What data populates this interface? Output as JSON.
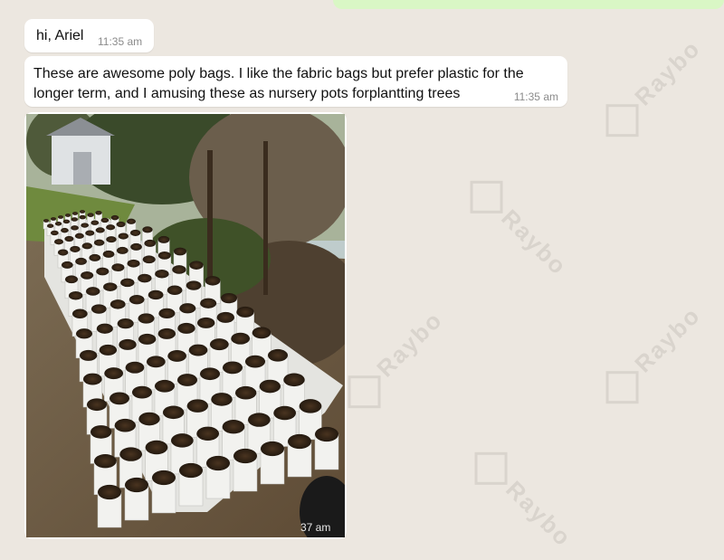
{
  "watermark": "Raybo",
  "messages": [
    {
      "text": "hi, Ariel",
      "time": "11:35 am"
    },
    {
      "text": "These are awesome poly bags. I like the fabric bags but prefer plastic for the longer term, and I amusing these as nursery pots forplantting trees",
      "time": "11:35 am"
    }
  ],
  "image_message": {
    "time_partial": "37 am"
  },
  "colors": {
    "background": "#ece7e0",
    "bubble_in": "#ffffff",
    "bubble_out": "#d9f7c5",
    "timestamp": "#8b8b8b"
  }
}
